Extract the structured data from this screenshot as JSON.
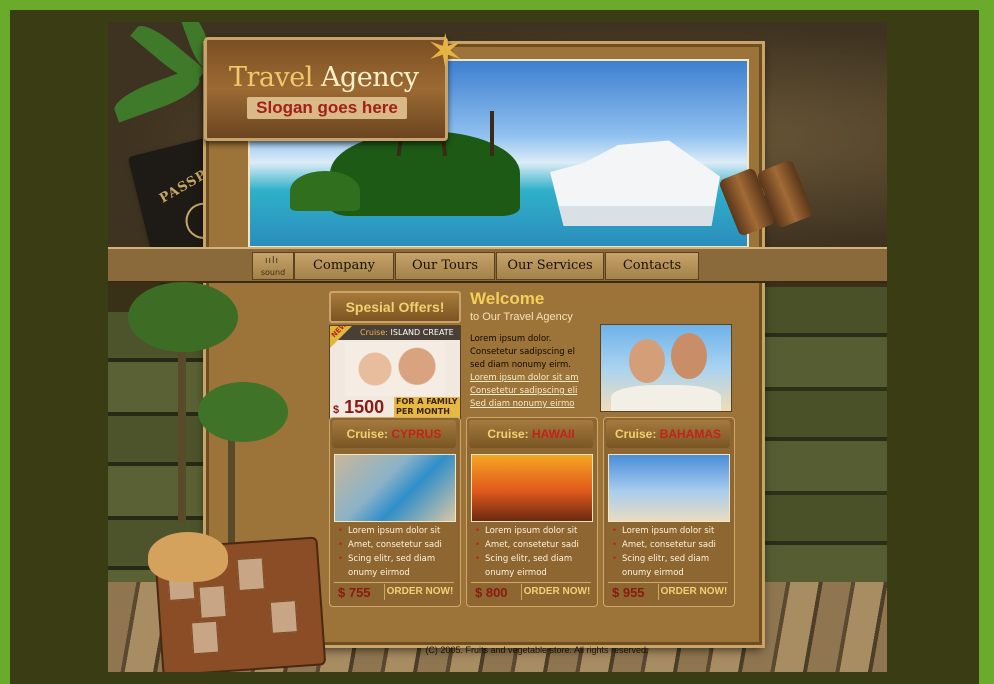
{
  "brand": {
    "title_part1": "Travel",
    "title_part2": "Agency",
    "slogan": "Slogan goes here"
  },
  "decor": {
    "passport_label": "PASSPORT"
  },
  "nav": {
    "sound_label": "sound",
    "items": [
      {
        "label": "Company"
      },
      {
        "label": "Our Tours"
      },
      {
        "label": "Our Services"
      },
      {
        "label": "Contacts"
      }
    ]
  },
  "special_offers": {
    "heading": "Spesial Offers!",
    "badge": "NEW",
    "cruise_prefix": "Cruise:",
    "cruise_name": "ISLAND CREATE",
    "currency": "$",
    "price": "1500",
    "note_line1": "FOR A FAMILY",
    "note_line2": "PER MONTH"
  },
  "welcome": {
    "title": "Welcome",
    "subtitle": "to Our Travel Agency",
    "lines": [
      "Lorem ipsum dolor.",
      "Consetetur sadipscing el",
      "sed diam nonumy eirm."
    ],
    "links": [
      "Lorem ipsum dolor sit am",
      "Consetetur sadipscing eli",
      "Sed diam nonumy eirmo"
    ]
  },
  "cruises": [
    {
      "prefix": "Cruise:",
      "name": "CYPRUS",
      "bullets": [
        "Lorem ipsum dolor sit",
        "Amet, consetetur sadi",
        "Scing elitr,  sed diam"
      ],
      "cont": "onumy eirmod",
      "price": "$ 755",
      "order": "ORDER NOW!"
    },
    {
      "prefix": "Cruise:",
      "name": "HAWAII",
      "bullets": [
        "Lorem ipsum dolor sit",
        "Amet, consetetur sadi",
        "Scing elitr,  sed diam"
      ],
      "cont": "onumy eirmod",
      "price": "$ 800",
      "order": "ORDER NOW!"
    },
    {
      "prefix": "Cruise:",
      "name": "BAHAMAS",
      "bullets": [
        "Lorem ipsum dolor sit",
        "Amet, consetetur sadi",
        "Scing elitr,  sed diam"
      ],
      "cont": "onumy eirmod",
      "price": "$ 955",
      "order": "ORDER NOW!"
    }
  ],
  "footer": {
    "copyright": "(C) 2005. Fruits and vegetable store. All rights reserved."
  },
  "colors": {
    "outer": "#6aab2c",
    "accent_gold": "#f3d070",
    "accent_red": "#c02419",
    "panel": "#9c7338"
  }
}
